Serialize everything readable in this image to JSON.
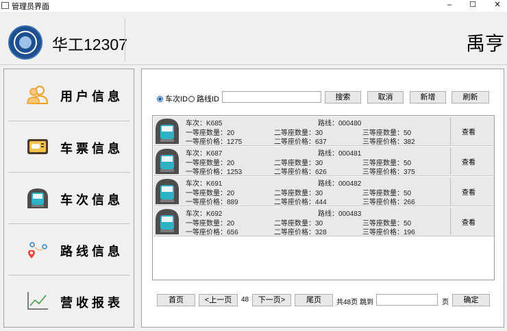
{
  "window": {
    "title": "管理员界面",
    "minimize": "–",
    "maximize": "☐",
    "close": "✕"
  },
  "header": {
    "brand": "华工12307",
    "username": "禹亨"
  },
  "sidebar": {
    "items": [
      {
        "label": "用户信息",
        "icon": "users-icon"
      },
      {
        "label": "车票信息",
        "icon": "ticket-icon"
      },
      {
        "label": "车次信息",
        "icon": "train-icon"
      },
      {
        "label": "路线信息",
        "icon": "route-icon"
      },
      {
        "label": "营收报表",
        "icon": "chart-icon"
      }
    ]
  },
  "search": {
    "radio_train": "车次ID",
    "radio_route": "路线ID",
    "selected": "车次ID",
    "value": "",
    "search_btn": "搜索",
    "cancel_btn": "取消",
    "add_btn": "新增",
    "refresh_btn": "刷新"
  },
  "list": {
    "labels": {
      "train": "车次：",
      "route": "路线：",
      "count1": "一等座数量：",
      "count2": "二等座数量：",
      "count3": "三等座数量：",
      "price1": "一等座价格：",
      "price2": "二等座价格：",
      "price3": "三等座价格："
    },
    "view_btn": "查看",
    "rows": [
      {
        "train": "K685",
        "route": "000480",
        "count1": "20",
        "count2": "30",
        "count3": "50",
        "price1": "1275",
        "price2": "637",
        "price3": "382"
      },
      {
        "train": "K687",
        "route": "000481",
        "count1": "20",
        "count2": "30",
        "count3": "50",
        "price1": "1253",
        "price2": "626",
        "price3": "375"
      },
      {
        "train": "K691",
        "route": "000482",
        "count1": "20",
        "count2": "30",
        "count3": "50",
        "price1": "889",
        "price2": "444",
        "price3": "266"
      },
      {
        "train": "K692",
        "route": "000483",
        "count1": "20",
        "count2": "30",
        "count3": "50",
        "price1": "656",
        "price2": "328",
        "price3": "196"
      }
    ]
  },
  "pager": {
    "first": "首页",
    "prev": "<上一页",
    "page": "48",
    "next": "下一页>",
    "last": "尾页",
    "total": "共48页",
    "jump_label": "跳到",
    "jump_value": "",
    "page_unit": "页",
    "confirm": "确定"
  }
}
